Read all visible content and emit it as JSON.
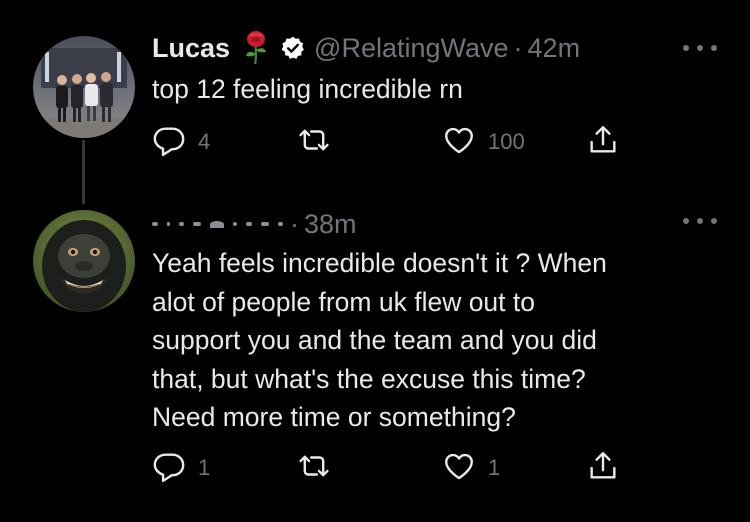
{
  "colors": {
    "background": "#000000",
    "text": "#e7e9ea",
    "muted": "#71767b",
    "thread_line": "#333639",
    "verified_badge": "#ffffff",
    "rose": "#d2202f"
  },
  "tweets": [
    {
      "display_name": "Lucas",
      "name_emoji": "rose-emoji",
      "verified": true,
      "handle": "@RelatingWave",
      "separator": "·",
      "time": "42m",
      "text": "top 12 feeling incredible rn",
      "reply_count": "4",
      "retweet_count": "",
      "like_count": "100"
    },
    {
      "display_name_redacted": true,
      "separator": "·",
      "time": "38m",
      "text": "Yeah feels incredible doesn't it ? When\nalot of people from uk flew out to\nsupport you and the team and you did\nthat, but what's the excuse this time?\nNeed more time or something?",
      "reply_count": "1",
      "retweet_count": "",
      "like_count": "1"
    }
  ],
  "icons": {
    "reply": "reply-icon",
    "retweet": "retweet-icon",
    "like": "heart-icon",
    "share": "share-icon",
    "more": "more-icon",
    "verified": "verified-badge-icon"
  }
}
